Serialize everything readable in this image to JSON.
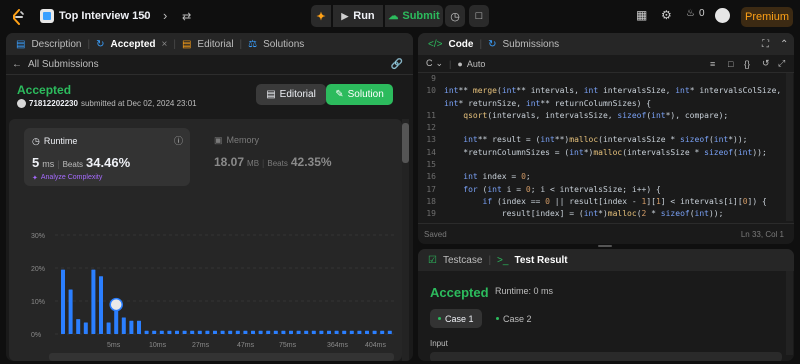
{
  "topbar": {
    "title": "Top Interview 150",
    "run_label": "Run",
    "submit_label": "Submit",
    "coins": "0",
    "premium_label": "Premium"
  },
  "left_tabs": {
    "description": "Description",
    "accepted": "Accepted",
    "editorial": "Editorial",
    "solutions": "Solutions"
  },
  "submission": {
    "back_label": "All Submissions",
    "status": "Accepted",
    "user": "71812202230",
    "submitted_text": "submitted at Dec 02, 2024 23:01",
    "editorial_btn": "Editorial",
    "solution_btn": "Solution"
  },
  "runtime": {
    "label": "Runtime",
    "value": "5",
    "unit": "ms",
    "beats_label": "Beats",
    "beats": "34.46%",
    "analyze": "Analyze Complexity"
  },
  "memory": {
    "label": "Memory",
    "value": "18.07",
    "unit": "MB",
    "beats_label": "Beats",
    "beats": "42.35%"
  },
  "chart_data": {
    "type": "bar",
    "y_ticks": [
      "30%",
      "20%",
      "10%",
      "0%"
    ],
    "ylim": [
      0,
      30
    ],
    "x_ticks": [
      "5ms",
      "10ms",
      "27ms",
      "47ms",
      "75ms",
      "364ms",
      "404ms"
    ],
    "values": [
      19.5,
      13.5,
      4.5,
      3.5,
      19.5,
      17.5,
      3.5,
      8.0,
      5.0,
      4.0,
      4.0,
      1.0,
      1.0,
      1.0,
      1.0,
      1.0,
      1.0,
      1.0,
      1.0,
      1.0,
      1.0,
      1.0,
      1.0,
      1.0,
      1.0,
      1.0,
      1.0,
      1.0,
      1.0,
      1.0,
      1.0,
      1.0,
      1.0,
      1.0,
      1.0,
      1.0,
      1.0,
      1.0,
      1.0,
      1.0,
      1.0,
      1.0,
      1.0,
      1.0
    ],
    "highlight_index": 7,
    "bar_color": "#2b7fff",
    "overview_ticks": [
      "5ms",
      "10ms",
      "27ms",
      "47ms",
      "75ms",
      "364ms",
      "404ms"
    ]
  },
  "code_tabs": {
    "code": "Code",
    "submissions": "Submissions",
    "language": "C",
    "auto": "Auto"
  },
  "code_lines": [
    {
      "n": "9",
      "t": ""
    },
    {
      "n": "10",
      "t": "int** merge(int** intervals, int intervalsSize, int* intervalsColSize,"
    },
    {
      "n": "",
      "t": "int* returnSize, int** returnColumnSizes) {"
    },
    {
      "n": "11",
      "t": "    qsort(intervals, intervalsSize, sizeof(int*), compare);"
    },
    {
      "n": "12",
      "t": ""
    },
    {
      "n": "13",
      "t": "    int** result = (int**)malloc(intervalsSize * sizeof(int*));"
    },
    {
      "n": "14",
      "t": "    *returnColumnSizes = (int*)malloc(intervalsSize * sizeof(int));"
    },
    {
      "n": "15",
      "t": ""
    },
    {
      "n": "16",
      "t": "    int index = 0;"
    },
    {
      "n": "17",
      "t": "    for (int i = 0; i < intervalsSize; i++) {"
    },
    {
      "n": "18",
      "t": "        if (index == 0 || result[index - 1][1] < intervals[i][0]) {"
    },
    {
      "n": "19",
      "t": "            result[index] = (int*)malloc(2 * sizeof(int));"
    },
    {
      "n": "20",
      "t": "            result[index][0] = intervals[i][0];"
    }
  ],
  "editor_status": {
    "saved": "Saved",
    "position": "Ln 33, Col 1"
  },
  "test_tabs": {
    "testcase": "Testcase",
    "result": "Test Result"
  },
  "test_result": {
    "status": "Accepted",
    "runtime": "Runtime: 0 ms",
    "case1": "Case 1",
    "case2": "Case 2",
    "input_label": "Input"
  }
}
